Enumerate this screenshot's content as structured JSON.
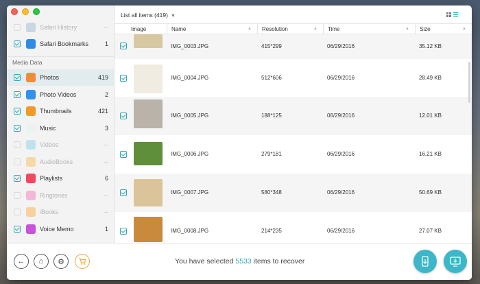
{
  "toolbar": {
    "list_title": "List all items (419)"
  },
  "columns": {
    "image": "Image",
    "name": "Name",
    "resolution": "Resolution",
    "time": "Time",
    "size": "Size"
  },
  "sidebar": {
    "top_items": [
      {
        "label": "Safari History",
        "count": "--",
        "checked": false,
        "dim": true,
        "icon": "safari-history-icon",
        "color": "#c9d6e3"
      },
      {
        "label": "Safari Bookmarks",
        "count": "1",
        "checked": true,
        "dim": false,
        "icon": "safari-bookmarks-icon",
        "color": "#2f8be6"
      }
    ],
    "section_title": "Media Data",
    "items": [
      {
        "label": "Photos",
        "count": "419",
        "checked": true,
        "dim": false,
        "active": true,
        "icon": "photos-icon",
        "color": "#f58a3b"
      },
      {
        "label": "Photo Videos",
        "count": "2",
        "checked": true,
        "dim": false,
        "icon": "photo-videos-icon",
        "color": "#3a8ee6"
      },
      {
        "label": "Thumbnails",
        "count": "421",
        "checked": true,
        "dim": false,
        "icon": "thumbnails-icon",
        "color": "#f19a2c"
      },
      {
        "label": "Music",
        "count": "3",
        "checked": true,
        "dim": false,
        "icon": "music-icon",
        "color": "#f0f0f0"
      },
      {
        "label": "Videos",
        "count": "--",
        "checked": false,
        "dim": true,
        "icon": "videos-icon",
        "color": "#bfe3ee"
      },
      {
        "label": "AudioBooks",
        "count": "--",
        "checked": false,
        "dim": true,
        "icon": "audiobooks-icon",
        "color": "#f7d9a8"
      },
      {
        "label": "Playlists",
        "count": "6",
        "checked": true,
        "dim": false,
        "icon": "playlists-icon",
        "color": "#ef4a5f"
      },
      {
        "label": "Ringtones",
        "count": "--",
        "checked": false,
        "dim": true,
        "icon": "ringtones-icon",
        "color": "#f1b9d6"
      },
      {
        "label": "iBooks",
        "count": "--",
        "checked": false,
        "dim": true,
        "icon": "ibooks-icon",
        "color": "#f8d29c"
      },
      {
        "label": "Voice Memo",
        "count": "1",
        "checked": true,
        "dim": false,
        "icon": "voice-memo-icon",
        "color": "#c554d9"
      }
    ]
  },
  "rows": [
    {
      "name": "IMG_0003.JPG",
      "resolution": "415*299",
      "time": "06/29/2016",
      "size": "35.12 KB",
      "thumb_color": "#d8c8a2"
    },
    {
      "name": "IMG_0004.JPG",
      "resolution": "512*606",
      "time": "06/29/2016",
      "size": "28.49 KB",
      "thumb_color": "#f0ece2"
    },
    {
      "name": "IMG_0005.JPG",
      "resolution": "188*125",
      "time": "06/29/2016",
      "size": "12.01 KB",
      "thumb_color": "#b9b3aa"
    },
    {
      "name": "IMG_0006.JPG",
      "resolution": "279*181",
      "time": "06/29/2016",
      "size": "16.21 KB",
      "thumb_color": "#5f8f3a"
    },
    {
      "name": "IMG_0007.JPG",
      "resolution": "580*348",
      "time": "06/29/2016",
      "size": "50.69 KB",
      "thumb_color": "#dcc49a"
    },
    {
      "name": "IMG_0008.JPG",
      "resolution": "214*235",
      "time": "06/29/2016",
      "size": "27.07 KB",
      "thumb_color": "#c98a3e"
    }
  ],
  "footer": {
    "status_prefix": "You have selected",
    "selected_count": "5533",
    "status_suffix": "items to recover",
    "buttons": [
      "back-icon",
      "home-icon",
      "settings-icon",
      "cart-icon"
    ],
    "action_buttons": [
      "recover-to-device-icon",
      "recover-to-computer-icon"
    ],
    "accent": "#2fa8b3"
  }
}
